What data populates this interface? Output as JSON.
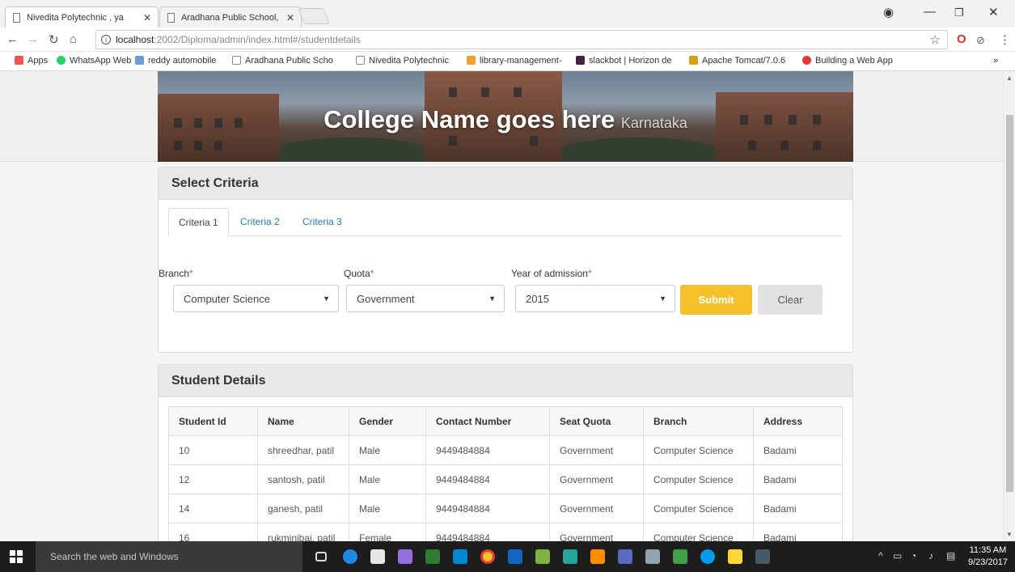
{
  "browser": {
    "tabs": [
      {
        "title": "Nivedita Polytechnic , ya",
        "active": true
      },
      {
        "title": "Aradhana Public School,",
        "active": false
      }
    ],
    "url_host": "localhost",
    "url_path": ":2002/Diploma/admin/index.html#/studentdetails",
    "bookmarks": [
      {
        "label": "Apps",
        "icon": "apps-grid-icon",
        "color": "#e55"
      },
      {
        "label": "WhatsApp Web",
        "icon": "whatsapp-icon",
        "color": "#25d366"
      },
      {
        "label": "reddy automobile",
        "icon": "page-icon",
        "color": "#6a9fd4"
      },
      {
        "label": "Aradhana Public Scho",
        "icon": "doc-icon",
        "color": "#ffffff"
      },
      {
        "label": "Nivedita Polytechnic",
        "icon": "doc-icon",
        "color": "#ffffff"
      },
      {
        "label": "library-management-",
        "icon": "pencil-icon",
        "color": "#f0a030"
      },
      {
        "label": "slackbot | Horizon de",
        "icon": "slack-icon",
        "color": "#4a2040"
      },
      {
        "label": "Apache Tomcat/7.0.6",
        "icon": "tomcat-icon",
        "color": "#d4a017"
      },
      {
        "label": "Building a Web App",
        "icon": "youtube-icon",
        "color": "#e53935"
      }
    ]
  },
  "header": {
    "title": "College Name goes here",
    "subtitle": "Karnataka"
  },
  "criteria": {
    "heading": "Select Criteria",
    "tabs": [
      "Criteria 1",
      "Criteria 2",
      "Criteria 3"
    ],
    "branch_label": "Branch",
    "quota_label": "Quota",
    "year_label": "Year of admission",
    "required_mark": "*",
    "branch_value": "Computer Science",
    "quota_value": "Government",
    "year_value": "2015",
    "submit_label": "Submit",
    "clear_label": "Clear"
  },
  "students": {
    "heading": "Student Details",
    "columns": [
      "Student Id",
      "Name",
      "Gender",
      "Contact Number",
      "Seat Quota",
      "Branch",
      "Address"
    ],
    "rows": [
      [
        "10",
        "shreedhar, patil",
        "Male",
        "9449484884",
        "Government",
        "Computer Science",
        "Badami"
      ],
      [
        "12",
        "santosh, patil",
        "Male",
        "9449484884",
        "Government",
        "Computer Science",
        "Badami"
      ],
      [
        "14",
        "ganesh, patil",
        "Male",
        "9449484884",
        "Government",
        "Computer Science",
        "Badami"
      ],
      [
        "16",
        "rukminibai, patil",
        "Female",
        "9449484884",
        "Government",
        "Computer Science",
        "Badami"
      ]
    ]
  },
  "taskbar": {
    "search_placeholder": "Search the web and Windows",
    "time": "11:35 AM",
    "date": "9/23/2017"
  }
}
